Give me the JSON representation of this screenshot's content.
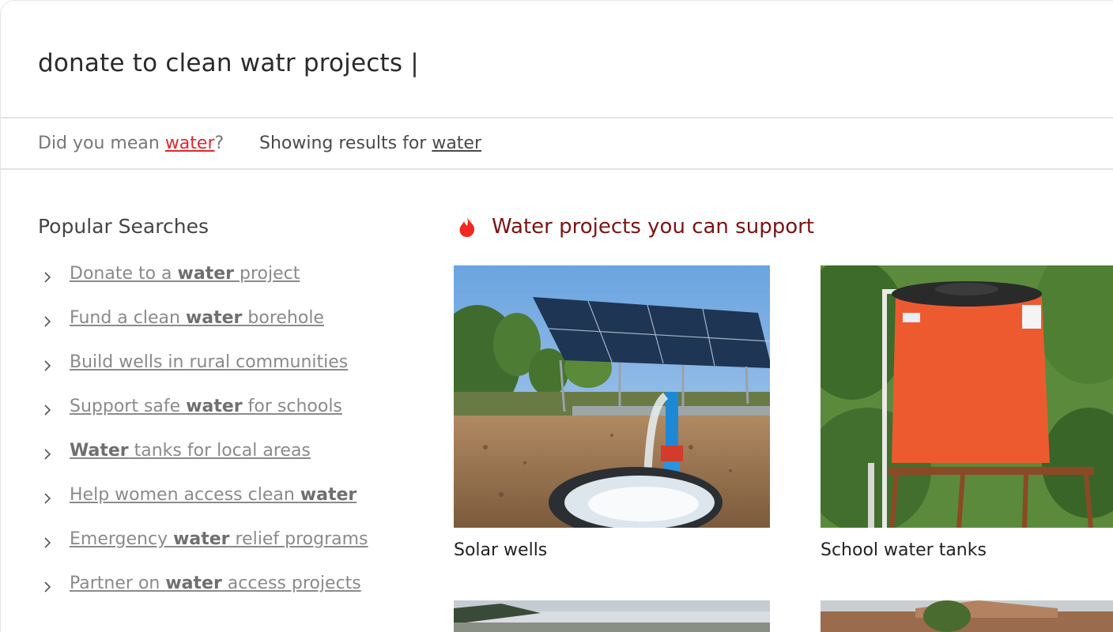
{
  "search": {
    "query": "donate to clean watr projects |"
  },
  "suggestion": {
    "did_you_mean_prefix": "Did you mean ",
    "did_you_mean_term": "water",
    "did_you_mean_suffix": "?",
    "showing_prefix": "Showing results for ",
    "showing_term": "water"
  },
  "popular": {
    "title": "Popular Searches",
    "items": [
      {
        "pre": "Donate to a ",
        "bold": "water",
        "post": " project"
      },
      {
        "pre": "Fund a clean ",
        "bold": "water",
        "post": " borehole"
      },
      {
        "pre": "Build wells in rural communities",
        "bold": "",
        "post": ""
      },
      {
        "pre": "Support safe ",
        "bold": "water",
        "post": " for schools"
      },
      {
        "pre": "",
        "bold": "Water",
        "post": " tanks for local areas"
      },
      {
        "pre": "Help women access clean ",
        "bold": "water",
        "post": ""
      },
      {
        "pre": "Emergency ",
        "bold": "water",
        "post": " relief programs"
      },
      {
        "pre": "Partner on ",
        "bold": "water",
        "post": " access projects"
      }
    ]
  },
  "projects": {
    "title": "Water projects you can support",
    "icon": "flame-icon",
    "cards": [
      {
        "caption": "Solar wells"
      },
      {
        "caption": "School water tanks"
      }
    ]
  },
  "colors": {
    "accent_red": "#e0272d",
    "heading_dark_red": "#7a1414",
    "divider": "#e3e3e3"
  }
}
